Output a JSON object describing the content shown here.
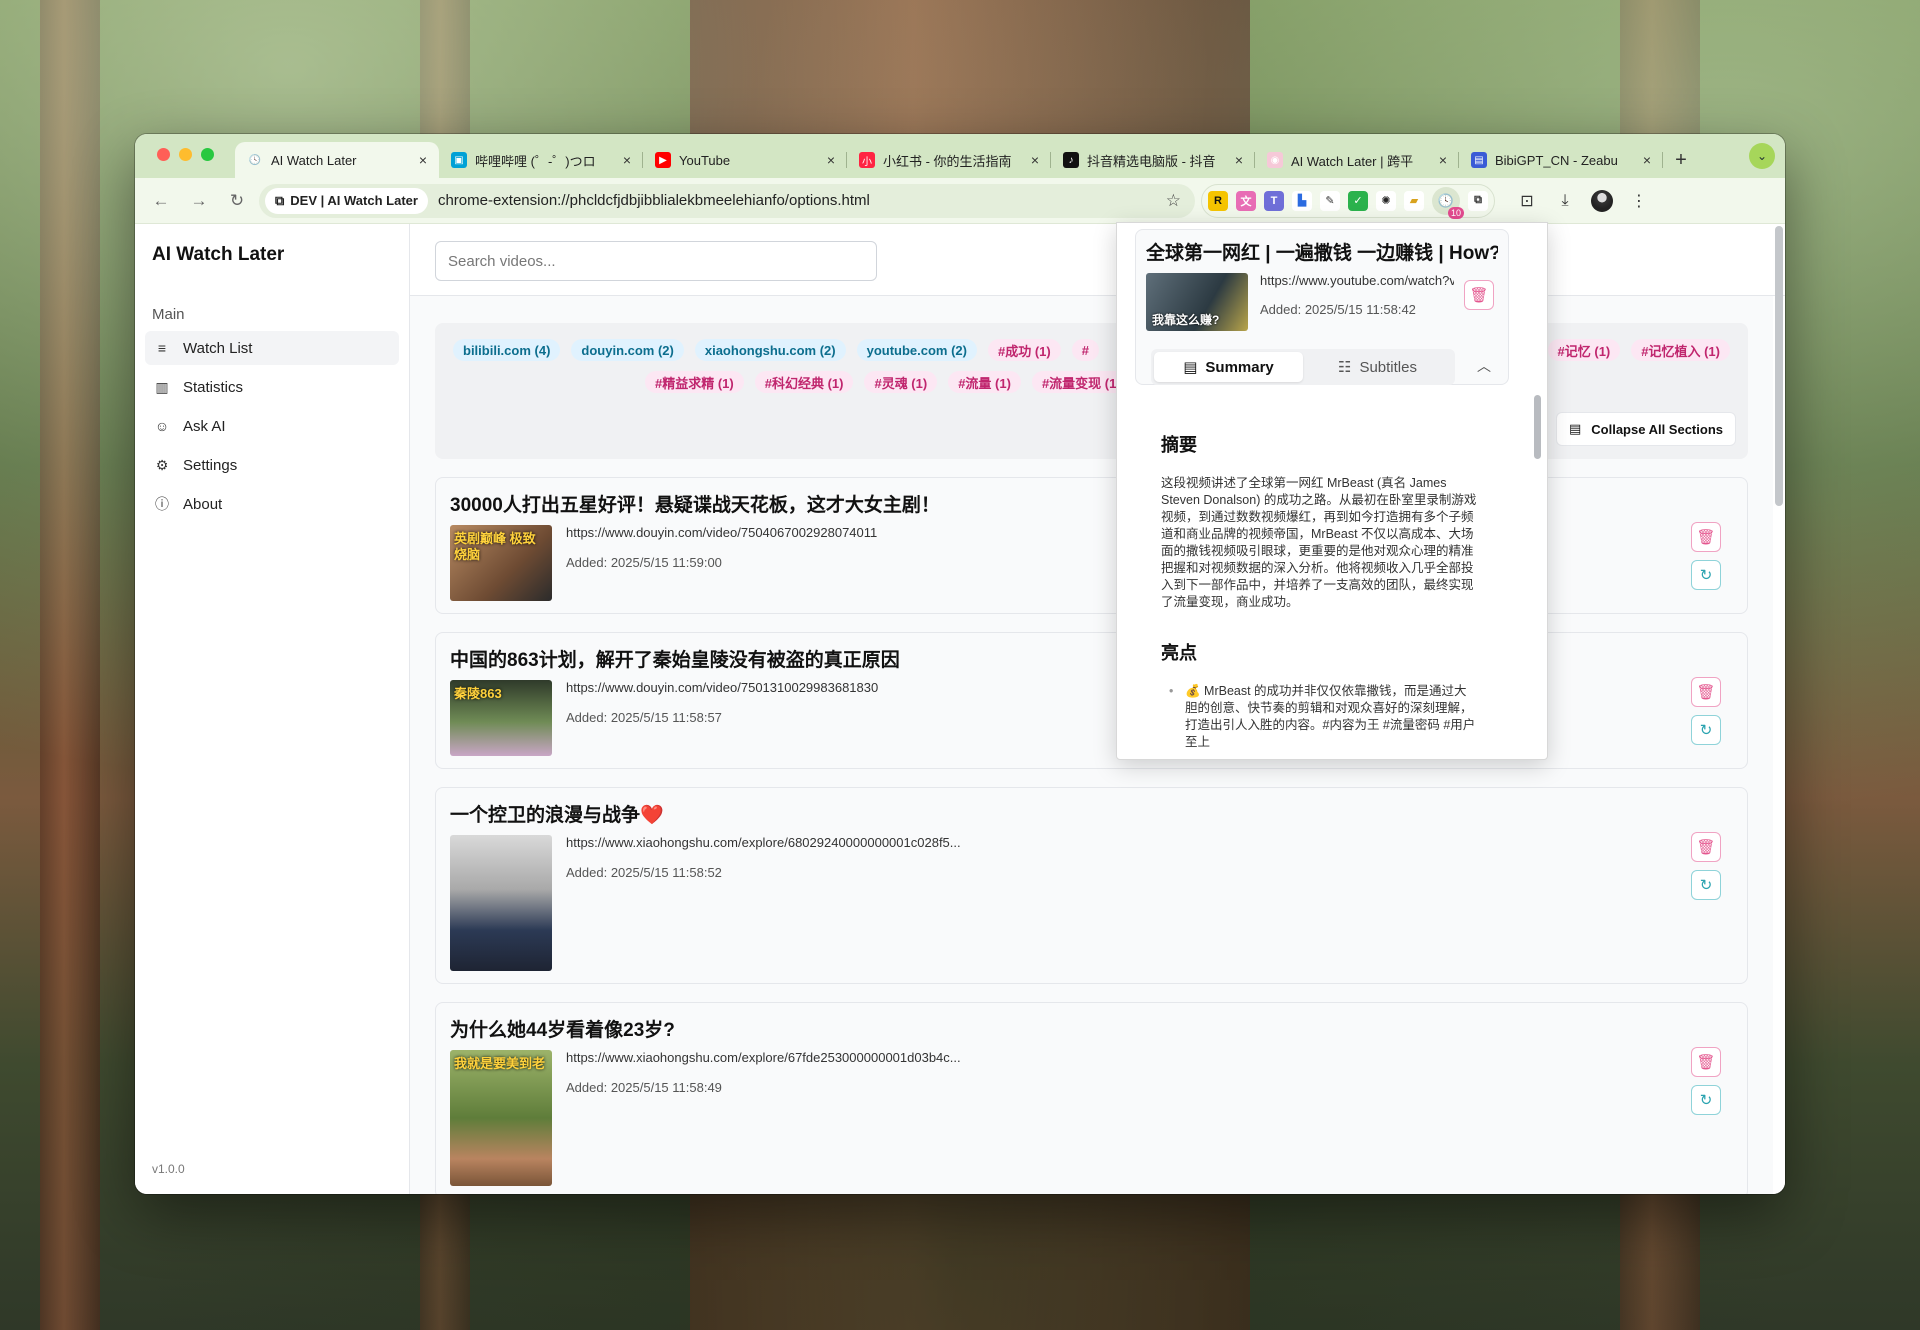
{
  "tabs": [
    {
      "title": "AI Watch Later",
      "active": true,
      "fav": "🕓",
      "fav_bg": "#f2f8ec"
    },
    {
      "title": "哔哩哔哩 (゜-゜)つロ",
      "active": false,
      "fav": "▣",
      "fav_bg": "#00a1d6"
    },
    {
      "title": "YouTube",
      "active": false,
      "fav": "▶",
      "fav_bg": "#ff0000"
    },
    {
      "title": "小红书 - 你的生活指南",
      "active": false,
      "fav": "小",
      "fav_bg": "#ff2442"
    },
    {
      "title": "抖音精选电脑版 - 抖音",
      "active": false,
      "fav": "♪",
      "fav_bg": "#111111"
    },
    {
      "title": "AI Watch Later | 跨平",
      "active": false,
      "fav": "◉",
      "fav_bg": "#f6c9d8"
    },
    {
      "title": "BibiGPT_CN - Zeabu",
      "active": false,
      "fav": "▤",
      "fav_bg": "#3b5bd6"
    }
  ],
  "toolbar": {
    "chip_label": "DEV | AI Watch Later",
    "url": "chrome-extension://phcldcfjdbjibblialekbmeelehianfo/options.html",
    "ext_badge": "10"
  },
  "sidebar": {
    "title": "AI Watch Later",
    "section": "Main",
    "items": [
      {
        "label": "Watch List",
        "icon": "list-icon",
        "glyph": "≡",
        "active": true
      },
      {
        "label": "Statistics",
        "icon": "bar-chart-icon",
        "glyph": "▥",
        "active": false
      },
      {
        "label": "Ask AI",
        "icon": "robot-icon",
        "glyph": "☺",
        "active": false
      },
      {
        "label": "Settings",
        "icon": "gear-icon",
        "glyph": "⚙",
        "active": false
      },
      {
        "label": "About",
        "icon": "info-icon",
        "glyph": "ⓘ",
        "active": false
      }
    ],
    "version": "v1.0.0"
  },
  "search": {
    "placeholder": "Search videos..."
  },
  "tags": {
    "row1": [
      "bilibili.com (4)",
      "douyin.com (2)",
      "xiaohongshu.com (2)",
      "youtube.com (2)",
      "#成功 (1)",
      "#"
    ],
    "row1_right": [
      "#记忆 (1)",
      "#记忆植入 (1)"
    ],
    "row2": [
      "#精益求精 (1)",
      "#科幻经典 (1)",
      "#灵魂 (1)",
      "#流量 (1)",
      "#流量变现 (1"
    ]
  },
  "collapse_label": "Collapse All Sections",
  "videos": [
    {
      "title": "30000人打出五星好评！悬疑谍战天花板，这才大女主剧！",
      "url": "https://www.douyin.com/video/7504067002928074011",
      "added": "Added: 2025/5/15 11:59:00",
      "thumb_text": "英剧巅峰 极致烧脑"
    },
    {
      "title": "中国的863计划，解开了秦始皇陵没有被盗的真正原因",
      "url": "https://www.douyin.com/video/7501310029983681830",
      "added": "Added: 2025/5/15 11:58:57",
      "thumb_text": "秦陵863"
    },
    {
      "title": "一个控卫的浪漫与战争❤️",
      "url": "https://www.xiaohongshu.com/explore/68029240000000001c028f5...",
      "added": "Added: 2025/5/15 11:58:52",
      "thumb_text": ""
    },
    {
      "title": "为什么她44岁看着像23岁?",
      "url": "https://www.xiaohongshu.com/explore/67fde253000000001d03b4c...",
      "added": "Added: 2025/5/15 11:58:49",
      "thumb_text": "我就是要美到老"
    }
  ],
  "popup": {
    "title": "全球第一网红 | 一遍撒钱 一边赚钱 | How?",
    "url": "https://www.youtube.com/watch?v=",
    "added": "Added: 2025/5/15 11:58:42",
    "thumb_text": "我靠这么赚?",
    "tab_summary": "Summary",
    "tab_subtitles": "Subtitles",
    "h_summary": "摘要",
    "summary": "这段视频讲述了全球第一网红 MrBeast (真名 James Steven Donalson) 的成功之路。从最初在卧室里录制游戏视频，到通过数数视频爆红，再到如今打造拥有多个子频道和商业品牌的视频帝国，MrBeast 不仅以高成本、大场面的撒钱视频吸引眼球，更重要的是他对观众心理的精准把握和对视频数据的深入分析。他将视频收入几乎全部投入到下一部作品中，并培养了一支高效的团队，最终实现了流量变现，商业成功。",
    "h_highlights": "亮点",
    "highlight_1": "💰 MrBeast 的成功并非仅仅依靠撒钱，而是通过大胆的创意、快节奏的剪辑和对观众喜好的深刻理解，打造出引人入胜的内容。#内容为王 #流量密码 #用户至上"
  },
  "colors": {
    "accent_pink": "#e4578f",
    "accent_teal": "#2aa3b0",
    "tabbar": "#d3e6c4"
  }
}
